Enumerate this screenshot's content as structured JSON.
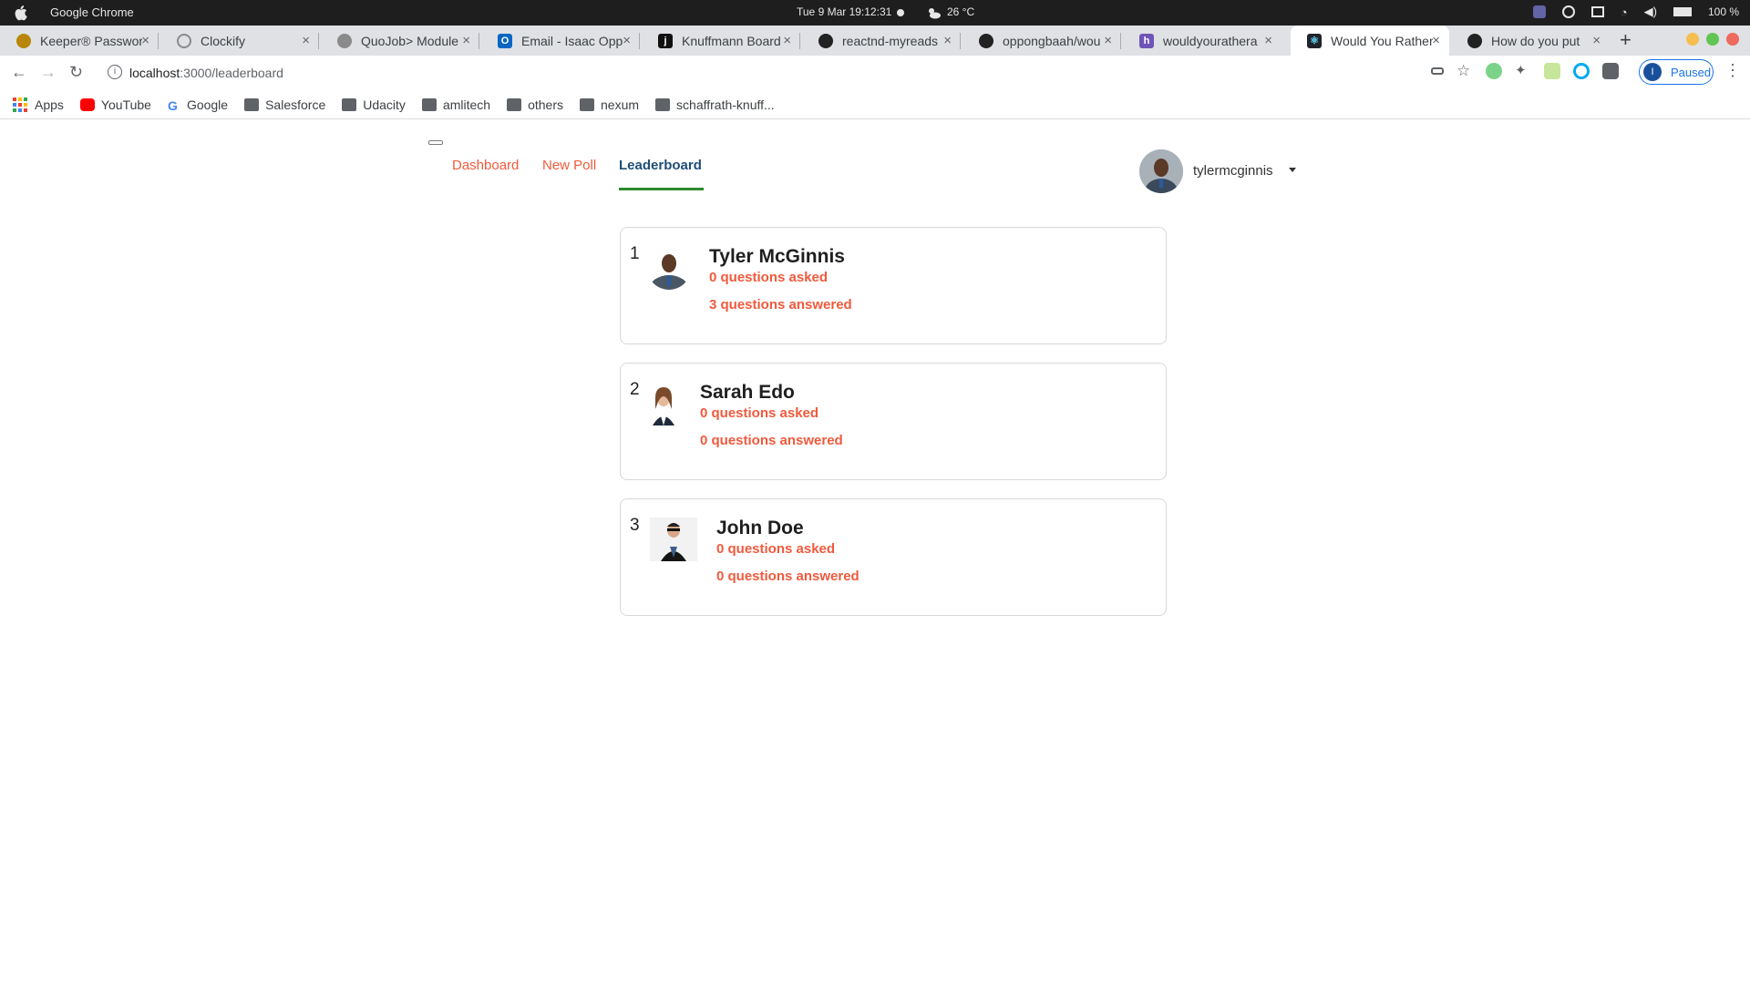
{
  "os": {
    "app_name": "Google Chrome",
    "clock": "Tue 9 Mar   19:12:31",
    "temperature": "26 °C",
    "battery": "100 %"
  },
  "tabs": [
    {
      "title": "Keeper® Password",
      "icon": "keeper-icon",
      "color": "#b8860b"
    },
    {
      "title": "Clockify",
      "icon": "clockify-icon",
      "color": "#8a8a8a"
    },
    {
      "title": "QuoJob> Module",
      "icon": "globe-icon",
      "color": "#8a8a8a"
    },
    {
      "title": "Email - Isaac Opp",
      "icon": "outlook-icon",
      "color": "#0a66c2"
    },
    {
      "title": "Knuffmann Board",
      "icon": "jira-icon",
      "color": "#111111"
    },
    {
      "title": "reactnd-myreads",
      "icon": "github-icon",
      "color": "#222222"
    },
    {
      "title": "oppongbaah/wou",
      "icon": "github-icon",
      "color": "#222222"
    },
    {
      "title": "wouldyourathera",
      "icon": "heroku-icon",
      "color": "#6f54b8"
    },
    {
      "title": "Would You Rather",
      "icon": "react-icon",
      "color": "#20232a"
    },
    {
      "title": "How do you put",
      "icon": "github-icon",
      "color": "#222222"
    }
  ],
  "address_bar": {
    "host": "localhost",
    "path": ":3000/leaderboard",
    "profile_initial": "I",
    "profile_status": "Paused"
  },
  "bookmarks": [
    {
      "label": "Apps",
      "icon": "apps-grid-icon"
    },
    {
      "label": "YouTube",
      "icon": "youtube-icon"
    },
    {
      "label": "Google",
      "icon": "google-icon"
    },
    {
      "label": "Salesforce",
      "icon": "folder-icon"
    },
    {
      "label": "Udacity",
      "icon": "folder-icon"
    },
    {
      "label": "amlitech",
      "icon": "folder-icon"
    },
    {
      "label": "others",
      "icon": "folder-icon"
    },
    {
      "label": "nexum",
      "icon": "folder-icon"
    },
    {
      "label": "schaffrath-knuff...",
      "icon": "folder-icon"
    }
  ],
  "nav": {
    "links": [
      "Dashboard",
      "New Poll",
      "Leaderboard"
    ],
    "active": "Leaderboard",
    "username": "tylermcginnis"
  },
  "leaderboard": [
    {
      "rank": "1",
      "name": "Tyler McGinnis",
      "asked": "0 questions asked",
      "answered": "3 questions answered"
    },
    {
      "rank": "2",
      "name": "Sarah Edo",
      "asked": "0 questions asked",
      "answered": "0 questions answered"
    },
    {
      "rank": "3",
      "name": "John Doe",
      "asked": "0 questions asked",
      "answered": "0 questions answered"
    }
  ],
  "colors": {
    "accent": "#f05a3c",
    "nav_active": "#1f4e79",
    "underline": "#2e8b2e"
  }
}
